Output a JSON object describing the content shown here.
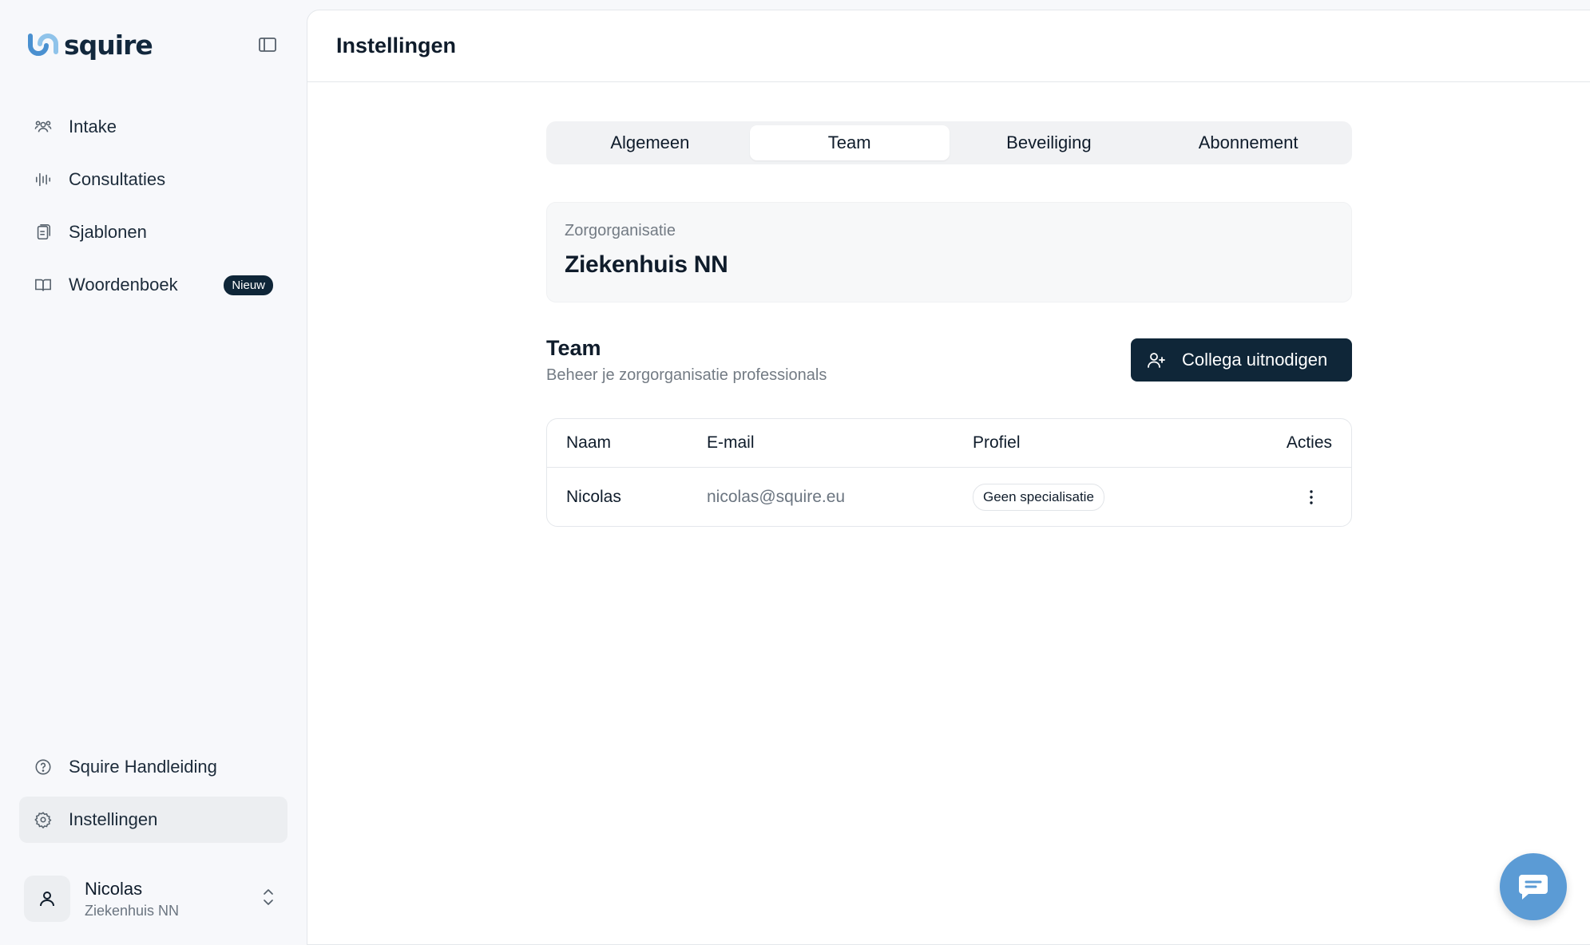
{
  "app": {
    "logo_text": "squire",
    "brand_color": "#5b9bd5",
    "dark_color": "#0f2638"
  },
  "sidebar": {
    "items": [
      {
        "label": "Intake",
        "icon": "users-icon"
      },
      {
        "label": "Consultaties",
        "icon": "waveform-icon"
      },
      {
        "label": "Sjablonen",
        "icon": "document-icon"
      },
      {
        "label": "Woordenboek",
        "icon": "book-icon",
        "badge": "Nieuw"
      }
    ],
    "bottom_items": [
      {
        "label": "Squire Handleiding",
        "icon": "help-icon"
      },
      {
        "label": "Instellingen",
        "icon": "gear-icon",
        "active": true
      }
    ],
    "user": {
      "name": "Nicolas",
      "org": "Ziekenhuis NN"
    }
  },
  "page": {
    "title": "Instellingen",
    "tabs": [
      "Algemeen",
      "Team",
      "Beveiliging",
      "Abonnement"
    ],
    "active_tab": "Team"
  },
  "organization": {
    "label": "Zorgorganisatie",
    "name": "Ziekenhuis NN"
  },
  "team": {
    "title": "Team",
    "subtitle": "Beheer je zorgorganisatie professionals",
    "invite_label": "Collega uitnodigen",
    "columns": [
      "Naam",
      "E-mail",
      "Profiel",
      "Acties"
    ],
    "rows": [
      {
        "name": "Nicolas",
        "email": "nicolas@squire.eu",
        "profile": "Geen specialisatie"
      }
    ]
  }
}
